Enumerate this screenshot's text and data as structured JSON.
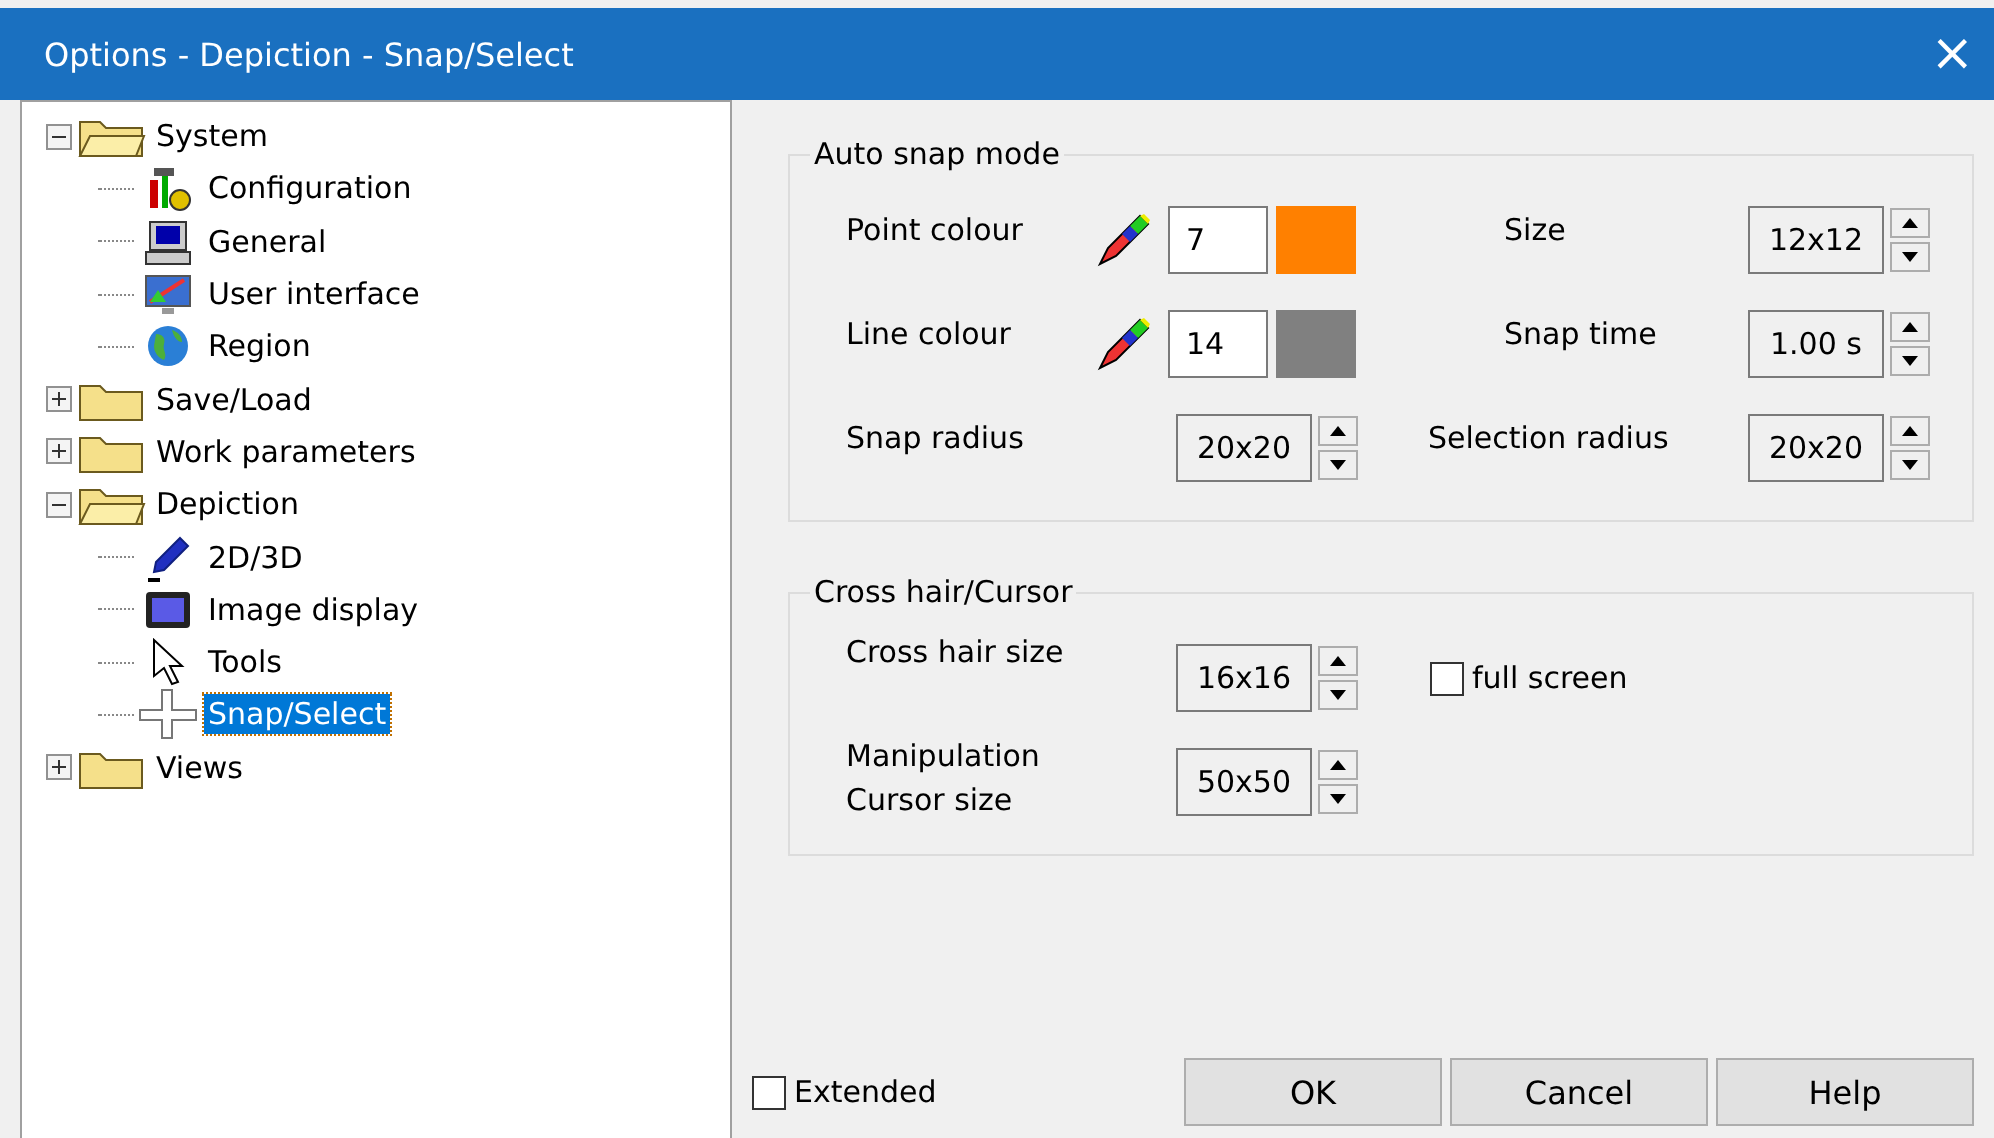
{
  "window": {
    "title": "Options - Depiction - Snap/Select",
    "close": "×"
  },
  "tree": [
    {
      "label": "System",
      "expanded": true,
      "selected": false,
      "children": [
        {
          "label": "Configuration",
          "selected": false
        },
        {
          "label": "General",
          "selected": false
        },
        {
          "label": "User interface",
          "selected": false
        },
        {
          "label": "Region",
          "selected": false
        }
      ]
    },
    {
      "label": "Save/Load",
      "expanded": false,
      "selected": false
    },
    {
      "label": "Work parameters",
      "expanded": false,
      "selected": false
    },
    {
      "label": "Depiction",
      "expanded": true,
      "selected": false,
      "children": [
        {
          "label": "2D/3D",
          "selected": false
        },
        {
          "label": "Image display",
          "selected": false
        },
        {
          "label": "Tools",
          "selected": false
        },
        {
          "label": "Snap/Select",
          "selected": true
        }
      ]
    },
    {
      "label": "Views",
      "expanded": false,
      "selected": false
    }
  ],
  "auto_snap": {
    "title": "Auto snap mode",
    "rows": [
      {
        "left": {
          "kind": "colour",
          "label": "Point colour",
          "value": "7",
          "color": "#ff8000"
        },
        "right": {
          "label": "Size",
          "value": "12x12"
        }
      },
      {
        "left": {
          "kind": "colour",
          "label": "Line colour",
          "value": "14",
          "color": "#808080"
        },
        "right": {
          "label": "Snap time",
          "value": "1.00 s"
        }
      },
      {
        "left": {
          "kind": "spinner",
          "label": "Snap radius",
          "value": "20x20"
        },
        "right": {
          "label": "Selection radius",
          "value": "20x20"
        }
      }
    ]
  },
  "cross_hair": {
    "title": "Cross hair/Cursor",
    "rows": [
      {
        "label": "Cross hair size",
        "value": "16x16",
        "checkbox": {
          "label": "full screen",
          "checked": false
        }
      },
      {
        "label": "Manipulation Cursor size",
        "value": "50x50"
      }
    ]
  },
  "extended": {
    "label": "Extended",
    "checked": false
  },
  "buttons": [
    "OK",
    "Cancel",
    "Help"
  ]
}
